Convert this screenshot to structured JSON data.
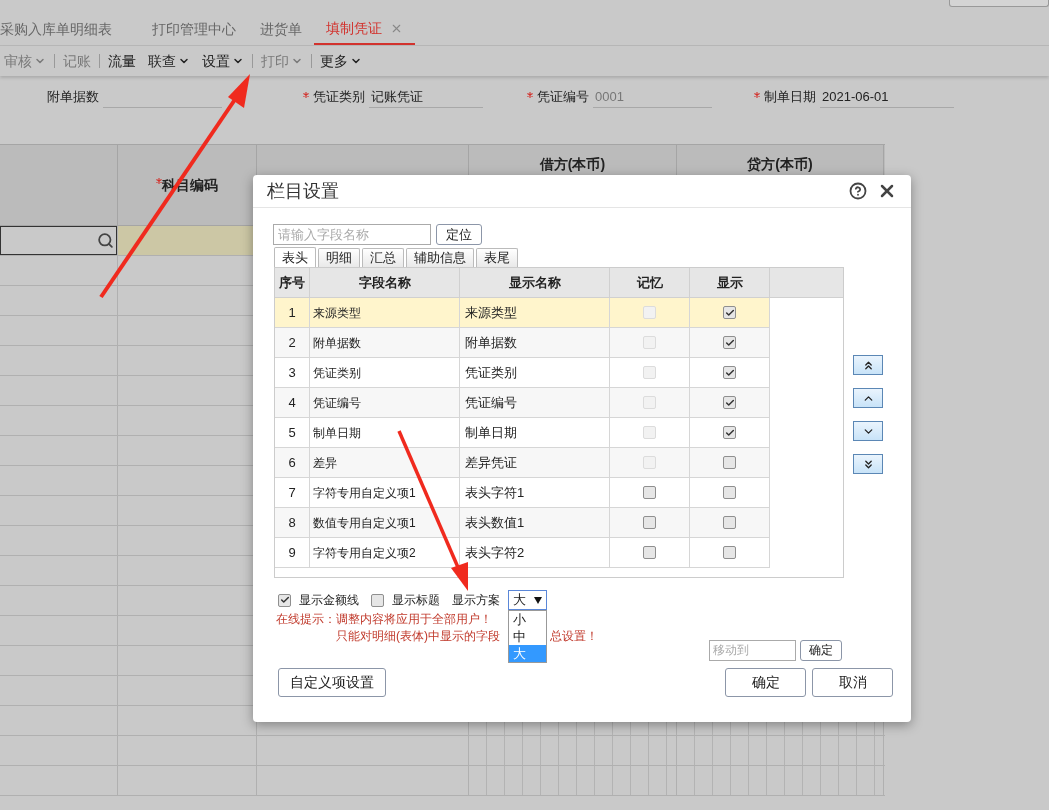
{
  "tabs": [
    {
      "label": "采购入库单明细表",
      "selected": false
    },
    {
      "label": "打印管理中心",
      "selected": false
    },
    {
      "label": "进货单",
      "selected": false
    },
    {
      "label": "填制凭证",
      "selected": true,
      "closable": true
    }
  ],
  "toolbar": [
    {
      "label": "审核",
      "caret": true,
      "disabled": true
    },
    {
      "label": "记账",
      "caret": false,
      "disabled": true
    },
    {
      "label": "流量",
      "caret": false,
      "disabled": false
    },
    {
      "label": "联查",
      "caret": true,
      "disabled": false
    },
    {
      "label": "设置",
      "caret": true,
      "disabled": false
    },
    {
      "label": "打印",
      "caret": true,
      "disabled": true
    },
    {
      "label": "更多",
      "caret": true,
      "disabled": false
    }
  ],
  "form": [
    {
      "label": "附单据数",
      "required": false,
      "disabled": false
    },
    {
      "label": "凭证类别",
      "required": true,
      "value": "记账凭证",
      "disabled": false
    },
    {
      "label": "凭证编号",
      "required": true,
      "value": "0001",
      "disabled": true
    },
    {
      "label": "制单日期",
      "required": true,
      "value": "2021-06-01",
      "disabled": false
    }
  ],
  "grid": {
    "columns": [
      {
        "label": "科目编码",
        "required": true
      },
      {
        "label": "借方(本币)",
        "required": false
      },
      {
        "label": "贷方(本币)",
        "required": false
      }
    ]
  },
  "dialog": {
    "title": "栏目设置",
    "search": {
      "placeholder": "请输入字段名称",
      "button": "定位"
    },
    "tabs": [
      {
        "label": "表头",
        "selected": true
      },
      {
        "label": "明细",
        "selected": false
      },
      {
        "label": "汇总",
        "selected": false
      },
      {
        "label": "辅助信息",
        "selected": false
      },
      {
        "label": "表尾",
        "selected": false
      }
    ],
    "columns": [
      "序号",
      "字段名称",
      "显示名称",
      "记忆",
      "显示"
    ],
    "rows": [
      {
        "no": "1",
        "field": "来源类型",
        "display": "来源类型",
        "memory": false,
        "memory_disabled": true,
        "show": true,
        "selected": true
      },
      {
        "no": "2",
        "field": "附单据数",
        "display": "附单据数",
        "memory": false,
        "memory_disabled": true,
        "show": true,
        "selected": false
      },
      {
        "no": "3",
        "field": "凭证类别",
        "display": "凭证类别",
        "memory": false,
        "memory_disabled": true,
        "show": true,
        "selected": false
      },
      {
        "no": "4",
        "field": "凭证编号",
        "display": "凭证编号",
        "memory": false,
        "memory_disabled": true,
        "show": true,
        "selected": false
      },
      {
        "no": "5",
        "field": "制单日期",
        "display": "制单日期",
        "memory": false,
        "memory_disabled": true,
        "show": true,
        "selected": false
      },
      {
        "no": "6",
        "field": "差异",
        "display": "差异凭证",
        "memory": false,
        "memory_disabled": true,
        "show": false,
        "selected": false
      },
      {
        "no": "7",
        "field": "字符专用自定义项1",
        "display": "表头字符1",
        "memory": false,
        "memory_disabled": false,
        "show": false,
        "selected": false
      },
      {
        "no": "8",
        "field": "数值专用自定义项1",
        "display": "表头数值1",
        "memory": false,
        "memory_disabled": false,
        "show": false,
        "selected": false
      },
      {
        "no": "9",
        "field": "字符专用自定义项2",
        "display": "表头字符2",
        "memory": false,
        "memory_disabled": false,
        "show": false,
        "selected": false
      }
    ],
    "options": [
      {
        "label": "显示金额线",
        "checked": true
      },
      {
        "label": "显示标题",
        "checked": false
      }
    ],
    "scheme": {
      "label": "显示方案",
      "value": "大",
      "options": [
        {
          "label": "小",
          "selected": false
        },
        {
          "label": "中",
          "selected": false
        },
        {
          "label": "大",
          "selected": true
        }
      ]
    },
    "hints": [
      "在线提示：调整内容将应用于全部用户！",
      "只能对明细(表体)中显示的字段",
      "总设置！"
    ],
    "move": {
      "placeholder": "移动到",
      "button": "确定"
    },
    "custom_button": "自定义项设置",
    "buttons": [
      "确定",
      "取消"
    ]
  }
}
